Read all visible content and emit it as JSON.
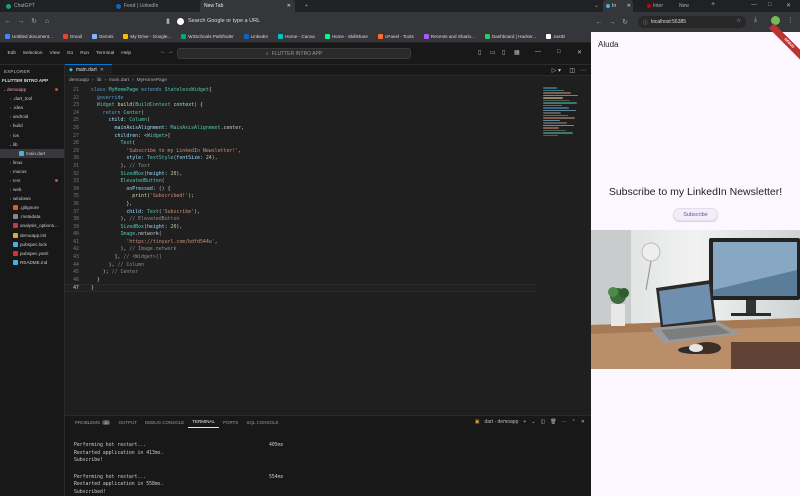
{
  "browser": {
    "tabs": [
      {
        "title": "ChatGPT",
        "color": "#10a37f"
      },
      {
        "title": "Feed | LinkedIn",
        "color": "#0a66c2"
      },
      {
        "title": "New Tab",
        "color": "#888888"
      }
    ],
    "omnibox_placeholder": "Search Google or type a URL",
    "bookmarks": [
      {
        "label": "Untitled document...",
        "color": "#4285f4"
      },
      {
        "label": "Gmail",
        "color": "#ea4335"
      },
      {
        "label": "Gemini",
        "color": "#8ab4f8"
      },
      {
        "label": "My Drive - Google...",
        "color": "#fbbc04"
      },
      {
        "label": "W3Schools Pathfinder",
        "color": "#04aa6d"
      },
      {
        "label": "LinkedIn",
        "color": "#0a66c2"
      },
      {
        "label": "Home - Canva",
        "color": "#00c4cc"
      },
      {
        "label": "Home - Skillshare",
        "color": "#00ff84"
      },
      {
        "label": "cPanel - Tools",
        "color": "#ff6c2c"
      },
      {
        "label": "Recents and Sharin...",
        "color": "#a259ff"
      },
      {
        "label": "Dashboard | Hacker...",
        "color": "#2ec866"
      },
      {
        "label": "JustD",
        "color": "#ffffff"
      }
    ]
  },
  "vscode": {
    "menu": [
      "Edit",
      "Selection",
      "View",
      "Go",
      "Run",
      "Terminal",
      "Help"
    ],
    "command_center": "FLUTTER INTRO APP",
    "explorer_title": "EXPLORER",
    "project_title": "FLUTTER INTRO APP",
    "tree": [
      {
        "label": "demoapp",
        "depth": 0,
        "chev": "v",
        "color": "#e8a0a0",
        "dot": true,
        "folder": true
      },
      {
        "label": ".dart_tool",
        "depth": 1,
        "chev": ">",
        "color": "#cccccc"
      },
      {
        "label": ".idea",
        "depth": 1,
        "chev": ">",
        "color": "#cccccc"
      },
      {
        "label": "android",
        "depth": 1,
        "chev": ">",
        "color": "#cccccc"
      },
      {
        "label": "build",
        "depth": 1,
        "chev": ">",
        "color": "#cccccc"
      },
      {
        "label": "ios",
        "depth": 1,
        "chev": ">",
        "color": "#cccccc"
      },
      {
        "label": "lib",
        "depth": 1,
        "chev": "v",
        "color": "#cccccc"
      },
      {
        "label": "main.dart",
        "depth": 2,
        "chev": "",
        "color": "#cccccc",
        "selected": true,
        "icon": "#41b3e7"
      },
      {
        "label": "linux",
        "depth": 1,
        "chev": ">",
        "color": "#cccccc"
      },
      {
        "label": "macos",
        "depth": 1,
        "chev": ">",
        "color": "#cccccc"
      },
      {
        "label": "test",
        "depth": 1,
        "chev": ">",
        "color": "#e8a0a0",
        "dot": true
      },
      {
        "label": "web",
        "depth": 1,
        "chev": ">",
        "color": "#cccccc"
      },
      {
        "label": "windows",
        "depth": 1,
        "chev": ">",
        "color": "#cccccc"
      },
      {
        "label": ".gitignore",
        "depth": 1,
        "chev": "",
        "color": "#cccccc",
        "icon": "#f05032"
      },
      {
        "label": ".metadata",
        "depth": 1,
        "chev": "",
        "color": "#cccccc",
        "icon": "#888888"
      },
      {
        "label": "analysis_options...",
        "depth": 1,
        "chev": "",
        "color": "#cccccc",
        "icon": "#cb3837"
      },
      {
        "label": "demoapp.iml",
        "depth": 1,
        "chev": "",
        "color": "#cccccc",
        "icon": "#e8a33d"
      },
      {
        "label": "pubspec.lock",
        "depth": 1,
        "chev": "",
        "color": "#cccccc",
        "icon": "#41b3e7"
      },
      {
        "label": "pubspec.yaml",
        "depth": 1,
        "chev": "",
        "color": "#cccccc",
        "icon": "#cb3837"
      },
      {
        "label": "README.md",
        "depth": 1,
        "chev": "",
        "color": "#cccccc",
        "icon": "#41b3e7"
      }
    ],
    "editor_tab": "main.dart",
    "breadcrumb": [
      "demoapp",
      "lib",
      "main.dart",
      "MyHomePage"
    ],
    "code": [
      {
        "n": "21",
        "t": [
          [
            "kw",
            "class "
          ],
          [
            "cls",
            "MyHomePage "
          ],
          [
            "kw",
            "extends "
          ],
          [
            "cls",
            "StatelessWidget"
          ],
          [
            "",
            "{"
          ]
        ]
      },
      {
        "n": "22",
        "t": [
          [
            "ann",
            "  @override"
          ]
        ]
      },
      {
        "n": "23",
        "t": [
          [
            "cls",
            "  Widget "
          ],
          [
            "fn",
            "build"
          ],
          [
            "",
            "("
          ],
          [
            "cls",
            "BuildContext "
          ],
          [
            "prop",
            "context"
          ],
          [
            "",
            ") {"
          ]
        ]
      },
      {
        "n": "24",
        "t": [
          [
            "kw",
            "    return "
          ],
          [
            "cls",
            "Center"
          ],
          [
            "",
            "("
          ]
        ]
      },
      {
        "n": "25",
        "t": [
          [
            "prop",
            "      child: "
          ],
          [
            "cls",
            "Column"
          ],
          [
            "",
            "("
          ]
        ]
      },
      {
        "n": "26",
        "t": [
          [
            "prop",
            "        mainAxisAlignment: "
          ],
          [
            "cls",
            "MainAxisAlignment"
          ],
          [
            "",
            ".center,"
          ]
        ]
      },
      {
        "n": "27",
        "t": [
          [
            "prop",
            "        children: "
          ],
          [
            "",
            "<"
          ],
          [
            "cls",
            "Widget"
          ],
          [
            "",
            ">["
          ]
        ]
      },
      {
        "n": "28",
        "t": [
          [
            "cls",
            "          Text"
          ],
          [
            "",
            "("
          ]
        ]
      },
      {
        "n": "29",
        "t": [
          [
            "str",
            "            'Subscribe to my LinkedIn Newsletter!'"
          ],
          [
            "",
            ","
          ]
        ]
      },
      {
        "n": "30",
        "t": [
          [
            "prop",
            "            style: "
          ],
          [
            "cls",
            "TextStyle"
          ],
          [
            "",
            "("
          ],
          [
            "prop",
            "fontSize: "
          ],
          [
            "num",
            "24"
          ],
          [
            "",
            "),"
          ]
        ]
      },
      {
        "n": "31",
        "t": [
          [
            "",
            "          ), "
          ],
          [
            "cmt",
            "// Text"
          ]
        ]
      },
      {
        "n": "32",
        "t": [
          [
            "cls",
            "          SizedBox"
          ],
          [
            "",
            "("
          ],
          [
            "prop",
            "height: "
          ],
          [
            "num",
            "20"
          ],
          [
            "",
            "),"
          ]
        ]
      },
      {
        "n": "33",
        "t": [
          [
            "cls",
            "          ElevatedButton"
          ],
          [
            "",
            "("
          ]
        ]
      },
      {
        "n": "34",
        "t": [
          [
            "prop",
            "            onPressed: "
          ],
          [
            "",
            "() {"
          ]
        ]
      },
      {
        "n": "35",
        "t": [
          [
            "fn",
            "              print"
          ],
          [
            "",
            "("
          ],
          [
            "str",
            "'Subscribed!'"
          ],
          [
            "",
            ");"
          ]
        ]
      },
      {
        "n": "36",
        "t": [
          [
            "",
            "            },"
          ]
        ]
      },
      {
        "n": "37",
        "t": [
          [
            "prop",
            "            child: "
          ],
          [
            "cls",
            "Text"
          ],
          [
            "",
            "("
          ],
          [
            "str",
            "'Subscribe'"
          ],
          [
            "",
            "),"
          ]
        ]
      },
      {
        "n": "38",
        "t": [
          [
            "",
            "          ), "
          ],
          [
            "cmt",
            "// ElevatedButton"
          ]
        ]
      },
      {
        "n": "39",
        "t": [
          [
            "cls",
            "          SizedBox"
          ],
          [
            "",
            "("
          ],
          [
            "prop",
            "height: "
          ],
          [
            "num",
            "20"
          ],
          [
            "",
            "),"
          ]
        ]
      },
      {
        "n": "40",
        "t": [
          [
            "cls",
            "          Image"
          ],
          [
            "",
            ".network("
          ]
        ]
      },
      {
        "n": "41",
        "t": [
          [
            "str",
            "            'https://tinyurl.com/bdfd544u'"
          ],
          [
            "",
            ","
          ]
        ]
      },
      {
        "n": "42",
        "t": [
          [
            "",
            "          ), "
          ],
          [
            "cmt",
            "// Image.network"
          ]
        ]
      },
      {
        "n": "43",
        "t": [
          [
            "",
            "        ], "
          ],
          [
            "cmt",
            "// <Widget>[]"
          ]
        ]
      },
      {
        "n": "44",
        "t": [
          [
            "",
            "      ), "
          ],
          [
            "cmt",
            "// Column"
          ]
        ]
      },
      {
        "n": "45",
        "t": [
          [
            "",
            "    ); "
          ],
          [
            "cmt",
            "// Center"
          ]
        ]
      },
      {
        "n": "46",
        "t": [
          [
            "",
            "  }"
          ]
        ]
      },
      {
        "n": "47",
        "t": [
          [
            "",
            "}"
          ]
        ],
        "current": true
      }
    ],
    "panel": {
      "tabs": [
        {
          "label": "PROBLEMS",
          "badge": "10"
        },
        {
          "label": "OUTPUT"
        },
        {
          "label": "DEBUG CONSOLE"
        },
        {
          "label": "TERMINAL",
          "active": true
        },
        {
          "label": "PORTS"
        },
        {
          "label": "SQL CONSOLE"
        }
      ],
      "terminal_selector": "dart - demoapp",
      "lines": [
        {
          "text": "Performing hot restart...",
          "right": "405ms"
        },
        {
          "text": "Restarted application in 413ms."
        },
        {
          "text": "Subscribe!"
        },
        {
          "gap": true
        },
        {
          "text": "Performing hot restart...",
          "right": "554ms"
        },
        {
          "text": "Restarted application in 558ms."
        },
        {
          "text": "Subscribed!"
        }
      ]
    }
  },
  "preview": {
    "tabs": [
      "In",
      "Inter",
      "New"
    ],
    "address": "localhost:56385",
    "app_title": "Aluda",
    "debug_banner": "DEBUG",
    "headline": "Subscribe to my LinkedIn Newsletter!",
    "button_label": "Subscribe"
  }
}
